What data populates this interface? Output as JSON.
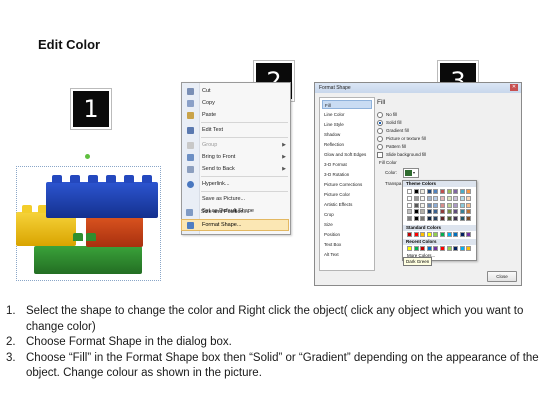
{
  "title": "Edit Color",
  "badges": [
    "1",
    "2",
    "3"
  ],
  "context_menu": {
    "items": [
      {
        "label": "Cut",
        "icon": "scissors-icon",
        "enabled": true,
        "submenu": false
      },
      {
        "label": "Copy",
        "icon": "copy-icon",
        "enabled": true,
        "submenu": false
      },
      {
        "label": "Paste",
        "icon": "paste-icon",
        "enabled": true,
        "submenu": false
      },
      {
        "label": "Edit Text",
        "icon": "edit-text-icon",
        "enabled": true,
        "submenu": false
      },
      {
        "label": "Group",
        "icon": "group-icon",
        "enabled": false,
        "submenu": true
      },
      {
        "label": "Bring to Front",
        "icon": "bring-front-icon",
        "enabled": true,
        "submenu": true
      },
      {
        "label": "Send to Back",
        "icon": "send-back-icon",
        "enabled": true,
        "submenu": true
      },
      {
        "label": "Hyperlink...",
        "icon": "hyperlink-icon",
        "enabled": true,
        "submenu": false
      },
      {
        "label": "Save as Picture...",
        "icon": "",
        "enabled": true,
        "submenu": false
      },
      {
        "label": "Set as Default Shape",
        "icon": "",
        "enabled": true,
        "submenu": false
      },
      {
        "label": "Size and Position...",
        "icon": "size-icon",
        "enabled": true,
        "submenu": false
      },
      {
        "label": "Format Shape...",
        "icon": "format-shape-icon",
        "enabled": true,
        "submenu": false,
        "highlighted": true
      }
    ]
  },
  "format_dialog": {
    "title": "Format Shape",
    "close_glyph": "✕",
    "nav": [
      "Fill",
      "Line Color",
      "Line Style",
      "Shadow",
      "Reflection",
      "Glow and Soft Edges",
      "3-D Format",
      "3-D Rotation",
      "Picture Corrections",
      "Picture Color",
      "Artistic Effects",
      "Crop",
      "Size",
      "Position",
      "Text Box",
      "Alt Text"
    ],
    "nav_selected": "Fill",
    "pane_title": "Fill",
    "options": [
      {
        "label": "No fill",
        "type": "radio",
        "checked": false
      },
      {
        "label": "Solid fill",
        "type": "radio",
        "checked": true
      },
      {
        "label": "Gradient fill",
        "type": "radio",
        "checked": false
      },
      {
        "label": "Picture or texture fill",
        "type": "radio",
        "checked": false
      },
      {
        "label": "Pattern fill",
        "type": "radio",
        "checked": false
      },
      {
        "label": "Slide background fill",
        "type": "checkbox",
        "checked": false
      }
    ],
    "fill_color_label": "Fill Color",
    "color_label": "Color:",
    "transparency_label": "Transpa",
    "close_label": "Close"
  },
  "palette": {
    "theme_header": "Theme Colors",
    "standard_header": "Standard Colors",
    "recent_header": "Recent Colors",
    "more_label": "More Colors...",
    "tooltip": "Dark Green",
    "theme_top": [
      "#ffffff",
      "#000000",
      "#eeece1",
      "#1f497d",
      "#4f81bd",
      "#c0504d",
      "#9bbb59",
      "#8064a2",
      "#4bacc6",
      "#f79646"
    ],
    "standard": [
      "#c00000",
      "#ff0000",
      "#ffc000",
      "#ffff00",
      "#92d050",
      "#00b050",
      "#00b0f0",
      "#0070c0",
      "#002060",
      "#7030a0"
    ],
    "recent": [
      "#ffff00",
      "#00b050",
      "#c00000",
      "#0070c0",
      "#7030a0",
      "#ff0000",
      "#92d050",
      "#002060",
      "#00b0f0",
      "#ffc000"
    ]
  },
  "steps": [
    {
      "num": "1.",
      "text": "Select the shape to change the color and Right click the object( click any object which you want to change color)"
    },
    {
      "num": "2.",
      "text": "Choose Format Shape in the dialog box."
    },
    {
      "num": "3.",
      "text": "Choose “Fill” in the Format Shape box then “Solid” or “Gradient” depending on the appearance of the object. Change colour as shown in the picture."
    }
  ],
  "colors": {
    "lego_blue": "#1f3fae",
    "lego_yellow": "#f2c21a",
    "lego_red": "#c8401a",
    "lego_green": "#2e8b2e",
    "highlight": "#fbe7b4"
  }
}
